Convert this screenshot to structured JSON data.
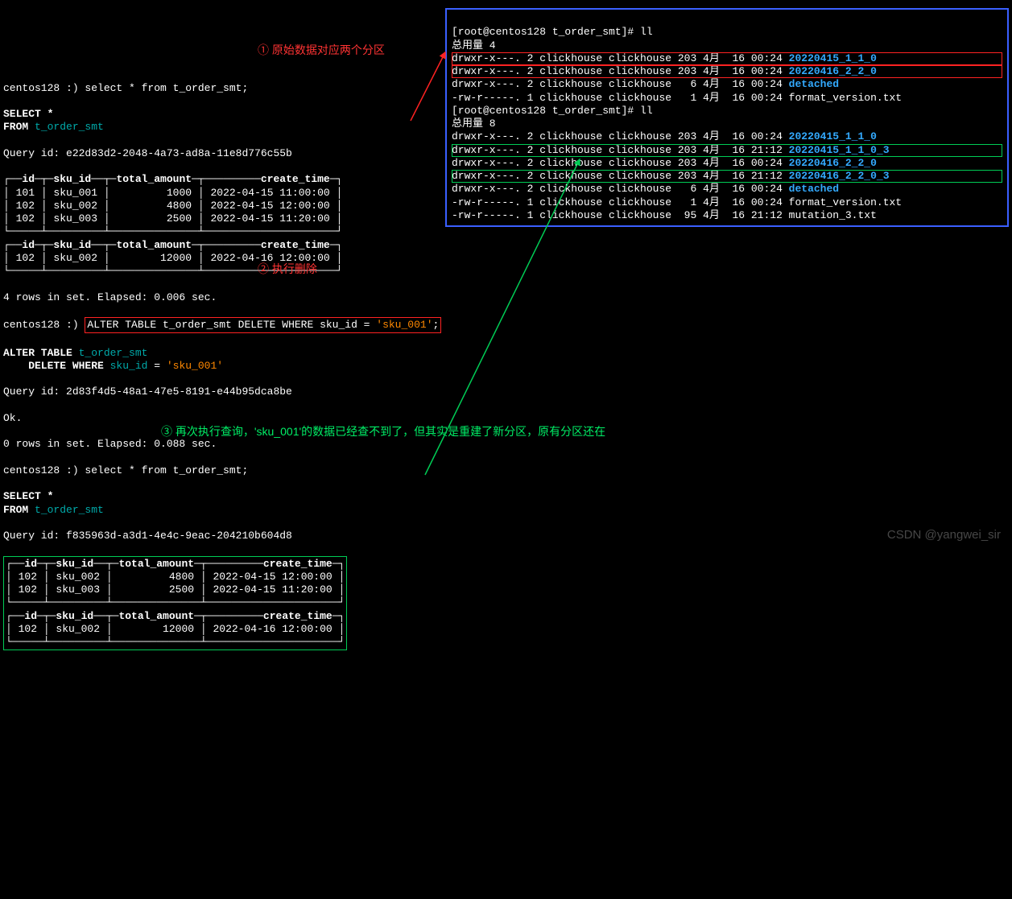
{
  "prompt_host": "centos128 :) ",
  "cmd1": "select * from t_order_smt;",
  "sql1_l1": "SELECT *",
  "sql1_l2_from": "FROM ",
  "sql1_table": "t_order_smt",
  "qid1_label": "Query id: ",
  "qid1": "e22d83d2-2048-4a73-ad8a-11e8d776c55b",
  "annot1": "① 原始数据对应两个分区",
  "table1": {
    "headers": [
      "id",
      "sku_id",
      "total_amount",
      "create_time"
    ],
    "rows": [
      {
        "id": "101",
        "sku": "sku_001",
        "amt": "1000",
        "ct": "2022-04-15 11:00:00"
      },
      {
        "id": "102",
        "sku": "sku_002",
        "amt": "4800",
        "ct": "2022-04-15 12:00:00"
      },
      {
        "id": "102",
        "sku": "sku_003",
        "amt": "2500",
        "ct": "2022-04-15 11:20:00"
      }
    ]
  },
  "table2": {
    "headers": [
      "id",
      "sku_id",
      "total_amount",
      "create_time"
    ],
    "rows": [
      {
        "id": "102",
        "sku": "sku_002",
        "amt": "12000",
        "ct": "2022-04-16 12:00:00"
      }
    ]
  },
  "rows_msg1": "4 rows in set. Elapsed: 0.006 sec.",
  "cmd2_full": "ALTER TABLE t_order_smt DELETE WHERE sku_id = 'sku_001';",
  "cmd2_pre": "ALTER TABLE t_order_smt DELETE WHERE sku_id = ",
  "cmd2_str": "'sku_001'",
  "cmd2_semi": ";",
  "sql2_l1": "ALTER TABLE ",
  "sql2_l1b": "t_order_smt",
  "sql2_l2a": "    DELETE WHERE ",
  "sql2_l2b": "sku_id",
  "sql2_l2c": " = ",
  "sql2_l2d": "'sku_001'",
  "annot2": "② 执行删除",
  "qid2": "2d83f4d5-48a1-47e5-8191-e44b95dca8be",
  "ok": "Ok.",
  "rows_msg2": "0 rows in set. Elapsed: 0.088 sec.",
  "cmd3": "select * from t_order_smt;",
  "sql3_l1": "SELECT *",
  "sql3_table": "t_order_smt",
  "annot3": "③ 再次执行查询，'sku_001'的数据已经查不到了，但其实是重建了新分区，原有分区还在",
  "qid3": "f835963d-a3d1-4e4c-9eac-204210b604d8",
  "table3": {
    "headers": [
      "id",
      "sku_id",
      "total_amount",
      "create_time"
    ],
    "rows": [
      {
        "id": "102",
        "sku": "sku_002",
        "amt": "4800",
        "ct": "2022-04-15 12:00:00"
      },
      {
        "id": "102",
        "sku": "sku_003",
        "amt": "2500",
        "ct": "2022-04-15 11:20:00"
      }
    ]
  },
  "table4": {
    "headers": [
      "id",
      "sku_id",
      "total_amount",
      "create_time"
    ],
    "rows": [
      {
        "id": "102",
        "sku": "sku_002",
        "amt": "12000",
        "ct": "2022-04-16 12:00:00"
      }
    ]
  },
  "rpanel": {
    "prompt": "[root@centos128 t_order_smt]# ",
    "ll": "ll",
    "total1": "总用量 4",
    "total2": "总用量 8",
    "ls1": [
      {
        "perm": "drwxr-x---. 2 clickhouse clickhouse 203 4月  16 00:24 ",
        "name": "20220415_1_1_0",
        "cls": "blue-link",
        "box": "red"
      },
      {
        "perm": "drwxr-x---. 2 clickhouse clickhouse 203 4月  16 00:24 ",
        "name": "20220416_2_2_0",
        "cls": "blue-link",
        "box": "red"
      },
      {
        "perm": "drwxr-x---. 2 clickhouse clickhouse   6 4月  16 00:24 ",
        "name": "detached",
        "cls": "blue-link",
        "box": ""
      },
      {
        "perm": "-rw-r-----. 1 clickhouse clickhouse   1 4月  16 00:24 ",
        "name": "format_version.txt",
        "cls": "",
        "box": ""
      }
    ],
    "ls2": [
      {
        "perm": "drwxr-x---. 2 clickhouse clickhouse 203 4月  16 00:24 ",
        "name": "20220415_1_1_0",
        "cls": "blue-link",
        "box": ""
      },
      {
        "perm": "drwxr-x---. 2 clickhouse clickhouse 203 4月  16 21:12 ",
        "name": "20220415_1_1_0_3",
        "cls": "blue-link",
        "box": "green"
      },
      {
        "perm": "drwxr-x---. 2 clickhouse clickhouse 203 4月  16 00:24 ",
        "name": "20220416_2_2_0",
        "cls": "blue-link",
        "box": ""
      },
      {
        "perm": "drwxr-x---. 2 clickhouse clickhouse 203 4月  16 21:12 ",
        "name": "20220416_2_2_0_3",
        "cls": "blue-link",
        "box": "green"
      },
      {
        "perm": "drwxr-x---. 2 clickhouse clickhouse   6 4月  16 00:24 ",
        "name": "detached",
        "cls": "blue-link",
        "box": ""
      },
      {
        "perm": "-rw-r-----. 1 clickhouse clickhouse   1 4月  16 00:24 ",
        "name": "format_version.txt",
        "cls": "",
        "box": ""
      },
      {
        "perm": "-rw-r-----. 1 clickhouse clickhouse  95 4月  16 21:12 ",
        "name": "mutation_3.txt",
        "cls": "",
        "box": ""
      }
    ]
  },
  "watermark": "CSDN @yangwei_sir"
}
